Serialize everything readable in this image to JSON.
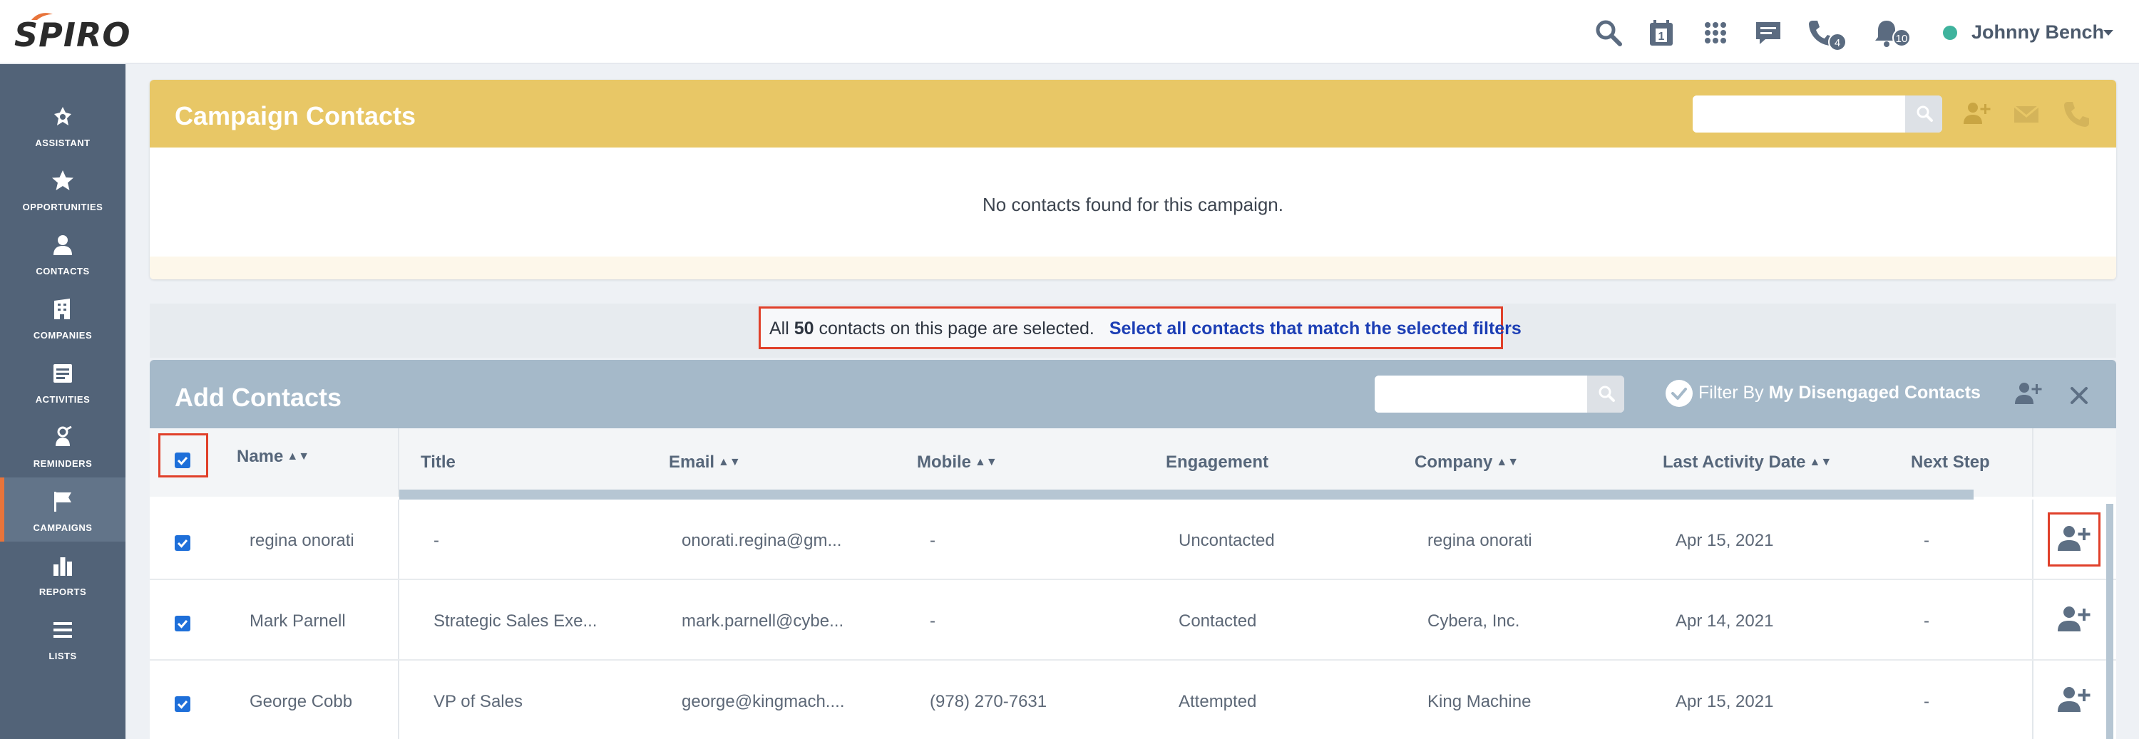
{
  "app": {
    "logo_text": "SPIRO"
  },
  "topbar": {
    "icons": [
      "search-icon",
      "calendar-icon",
      "apps-grid-icon",
      "messages-icon",
      "phone-icon",
      "bell-icon"
    ],
    "phone_badge": "4",
    "notifications_badge": "10",
    "user_name": "Johnny Bench",
    "status_color": "#3fb39d"
  },
  "sidebar": {
    "active": "CAMPAIGNS",
    "items": [
      {
        "label": "ASSISTANT",
        "icon": "assistant-icon"
      },
      {
        "label": "OPPORTUNITIES",
        "icon": "star-icon"
      },
      {
        "label": "CONTACTS",
        "icon": "person-icon"
      },
      {
        "label": "COMPANIES",
        "icon": "building-icon"
      },
      {
        "label": "ACTIVITIES",
        "icon": "activities-icon"
      },
      {
        "label": "REMINDERS",
        "icon": "reminder-icon"
      },
      {
        "label": "CAMPAIGNS",
        "icon": "flag-icon"
      },
      {
        "label": "REPORTS",
        "icon": "bar-chart-icon"
      },
      {
        "label": "LISTS",
        "icon": "list-icon"
      }
    ]
  },
  "campaign_contacts": {
    "title": "Campaign Contacts",
    "search_placeholder": "",
    "empty_message": "No contacts found for this campaign.",
    "accent_color": "#e8c766"
  },
  "selection_banner": {
    "prefix": "All",
    "count": "50",
    "suffix": "contacts on this page are selected.",
    "link": "Select all contacts that match the selected filters"
  },
  "add_contacts": {
    "title": "Add Contacts",
    "search_placeholder": "",
    "filter_prefix": "Filter By",
    "filter_value": "My Disengaged Contacts",
    "header_color": "#a5b9c9",
    "columns": [
      "Name",
      "Title",
      "Email",
      "Mobile",
      "Engagement",
      "Company",
      "Last Activity Date",
      "Next Step"
    ],
    "sortable": [
      true,
      false,
      true,
      true,
      false,
      true,
      true,
      false
    ],
    "rows": [
      {
        "name": "regina onorati",
        "title": "-",
        "email": "onorati.regina@gm...",
        "mobile": "-",
        "engagement": "Uncontacted",
        "company": "regina onorati",
        "last_activity": "Apr 15, 2021",
        "next_step": "-",
        "checked": true
      },
      {
        "name": "Mark Parnell",
        "title": "Strategic Sales Exe...",
        "email": "mark.parnell@cybe...",
        "mobile": "-",
        "engagement": "Contacted",
        "company": "Cybera, Inc.",
        "last_activity": "Apr 14, 2021",
        "next_step": "-",
        "checked": true
      },
      {
        "name": "George Cobb",
        "title": "VP of Sales",
        "email": "george@kingmach....",
        "mobile": "(978) 270-7631",
        "engagement": "Attempted",
        "company": "King Machine",
        "last_activity": "Apr 15, 2021",
        "next_step": "-",
        "checked": true
      }
    ]
  }
}
